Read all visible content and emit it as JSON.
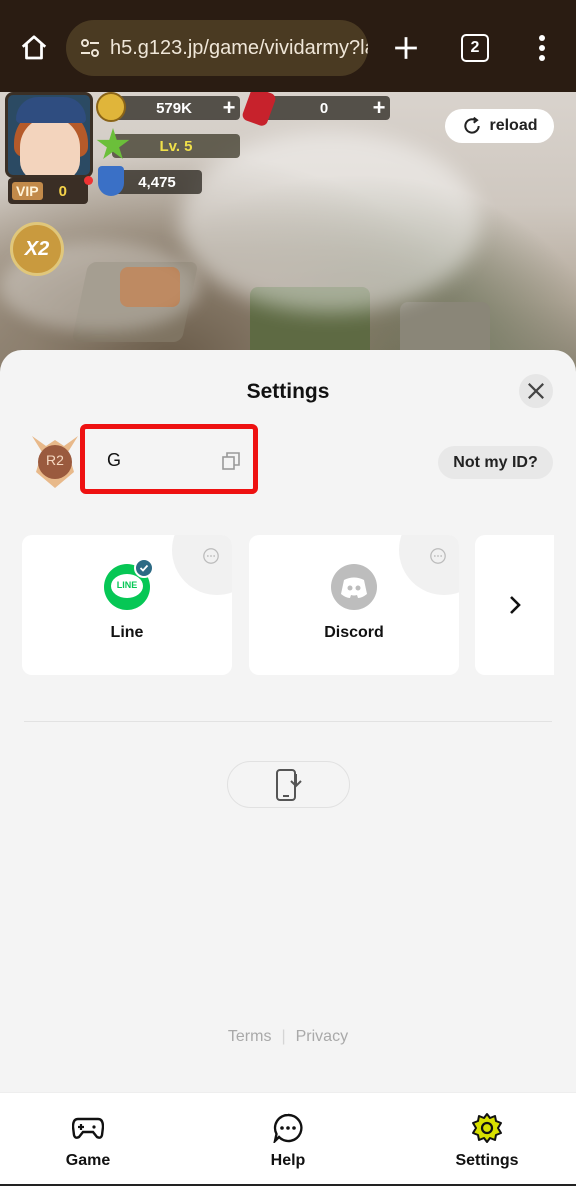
{
  "browser": {
    "url": "h5.g123.jp/game/vividarmy?la",
    "tab_count": "2",
    "icons": [
      "home-icon",
      "site-settings-icon",
      "new-tab-icon",
      "tabs-icon",
      "menu-icon"
    ]
  },
  "game_hud": {
    "vip_label": "VIP",
    "vip_level": "0",
    "gold": "579K",
    "gems": "0",
    "level": "Lv. 5",
    "power": "4,475",
    "boost_label": "X2",
    "reload_label": "reload"
  },
  "settings": {
    "title": "Settings",
    "rank": "R2",
    "user_id": "G",
    "not_my_id_label": "Not my ID?",
    "accounts": [
      {
        "label": "Line",
        "logo_text": "LINE",
        "linked": true,
        "color": "#06c755"
      },
      {
        "label": "Discord",
        "linked": false,
        "color": "#bdbdbd"
      }
    ],
    "terms_label": "Terms",
    "privacy_label": "Privacy"
  },
  "bottom_nav": {
    "items": [
      {
        "label": "Game",
        "icon": "gamepad-icon"
      },
      {
        "label": "Help",
        "icon": "chat-bubble-icon"
      },
      {
        "label": "Settings",
        "icon": "gear-icon"
      }
    ]
  },
  "colors": {
    "highlight_box": "#e11111",
    "settings_active": "#d8e000",
    "line_green": "#06c755"
  }
}
